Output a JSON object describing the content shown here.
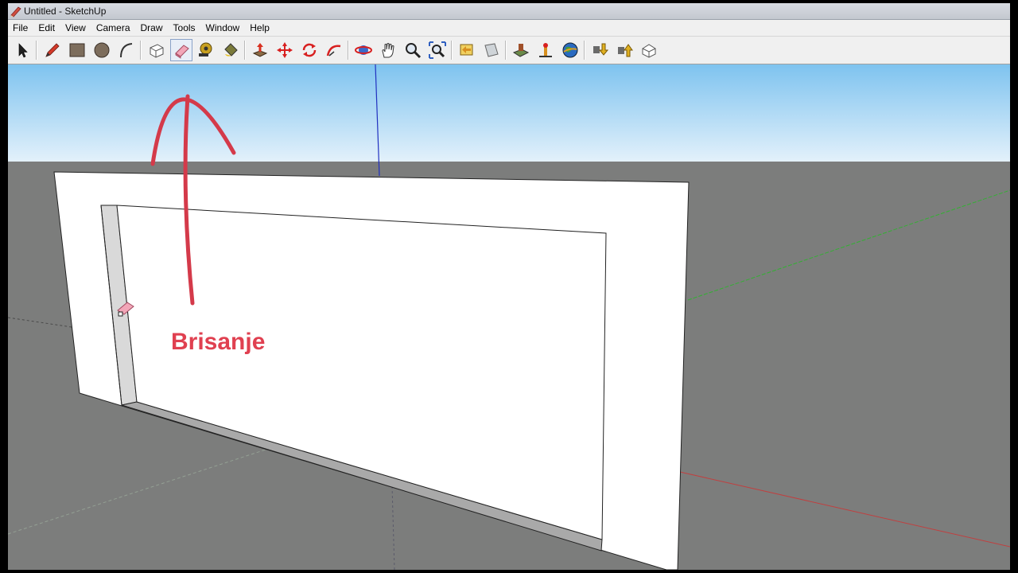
{
  "window": {
    "title": "Untitled - SketchUp"
  },
  "menu": [
    "File",
    "Edit",
    "View",
    "Camera",
    "Draw",
    "Tools",
    "Window",
    "Help"
  ],
  "toolbar": {
    "buttons": [
      {
        "name": "select-tool",
        "icon": "arrow-cursor-icon"
      },
      {
        "name": "pencil-tool",
        "icon": "pencil-icon"
      },
      {
        "name": "rectangle-tool",
        "icon": "rectangle-icon"
      },
      {
        "name": "circle-tool",
        "icon": "circle-icon"
      },
      {
        "name": "arc-tool",
        "icon": "arc-icon"
      },
      {
        "name": "make-component-tool",
        "icon": "component-icon"
      },
      {
        "name": "eraser-tool",
        "icon": "eraser-icon",
        "active": true
      },
      {
        "name": "tape-measure-tool",
        "icon": "tape-measure-icon"
      },
      {
        "name": "paint-bucket-tool",
        "icon": "paint-bucket-icon"
      },
      {
        "name": "push-pull-tool",
        "icon": "push-pull-icon"
      },
      {
        "name": "move-tool",
        "icon": "move-icon"
      },
      {
        "name": "rotate-tool",
        "icon": "rotate-icon"
      },
      {
        "name": "follow-me-tool",
        "icon": "follow-me-icon"
      },
      {
        "name": "orbit-tool",
        "icon": "orbit-icon"
      },
      {
        "name": "pan-tool",
        "icon": "hand-icon"
      },
      {
        "name": "zoom-tool",
        "icon": "magnifier-icon"
      },
      {
        "name": "zoom-extents-tool",
        "icon": "zoom-extents-icon"
      },
      {
        "name": "previous-view-tool",
        "icon": "previous-view-icon"
      },
      {
        "name": "next-view-tool",
        "icon": "next-view-icon"
      },
      {
        "name": "add-location-tool",
        "icon": "add-location-icon"
      },
      {
        "name": "toggle-terrain-tool",
        "icon": "terrain-icon"
      },
      {
        "name": "preview-google-earth-tool",
        "icon": "globe-icon"
      },
      {
        "name": "get-models-tool",
        "icon": "get-models-icon"
      },
      {
        "name": "share-model-tool",
        "icon": "share-model-icon"
      },
      {
        "name": "share-component-tool",
        "icon": "share-component-icon"
      }
    ]
  },
  "viewport": {
    "caption": "Brisanje",
    "colors": {
      "sky_top": "#7ec3ef",
      "sky_bottom": "#e3f1fb",
      "ground": "#7c7d7c",
      "caption": "#e04050",
      "red_axis": "#c04040",
      "green_axis": "#33b033",
      "blue_axis": "#2030c0"
    }
  }
}
